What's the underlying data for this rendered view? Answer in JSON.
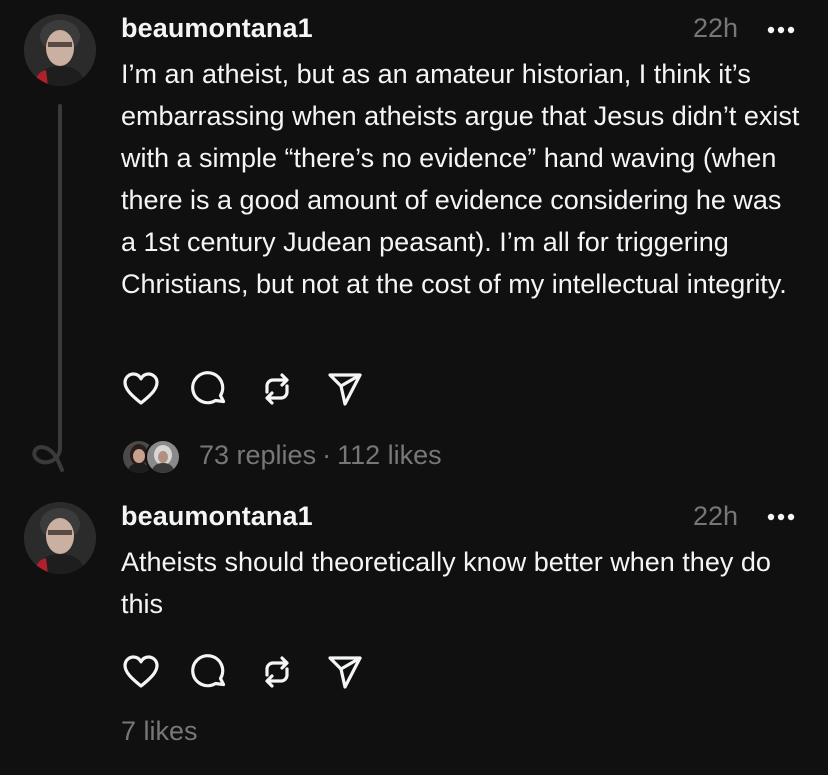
{
  "posts": [
    {
      "username": "beaumontana1",
      "time": "22h",
      "text": "I’m an atheist, but as an amateur historian, I think it’s embarrassing when atheists argue that Jesus didn’t exist with a simple “there’s no evidence” hand waving (when there is a good amount of evidence considering he was a 1st century Judean peasant). I’m all for triggering Christians, but not at the cost of my intellectual integrity.",
      "replies": "73 replies",
      "separator": "·",
      "likes": "112 likes"
    },
    {
      "username": "beaumontana1",
      "time": "22h",
      "text": "Atheists should theoretically know better when they do this",
      "likes": "7 likes"
    }
  ],
  "icons": {
    "like": "heart-icon",
    "comment": "comment-bubble-icon",
    "repost": "repost-icon",
    "share": "send-icon",
    "more": "more-horizontal-icon"
  },
  "colors": {
    "background": "#101010",
    "primary_text": "#f3f5f7",
    "secondary_text": "#777777",
    "thread_line": "#3a3a3a"
  }
}
